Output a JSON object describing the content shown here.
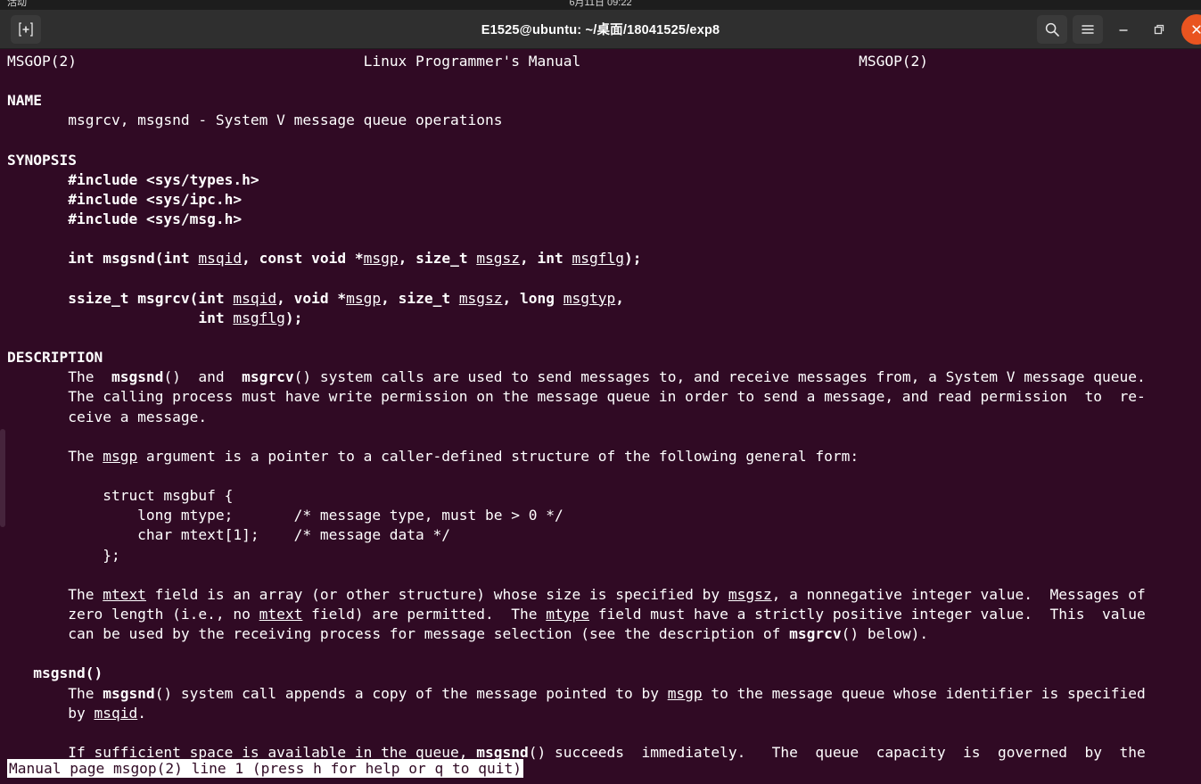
{
  "system_bar": {
    "left_label": "活动",
    "center_label": "6月11日 09:22",
    "right_label": ""
  },
  "titlebar": {
    "new_tab_label": "+",
    "title": "E1525@ubuntu: ~/桌面/18041525/exp8",
    "search_icon": "search-icon",
    "menu_icon": "hamburger-menu-icon",
    "minimize_label": "—",
    "maximize_label": "□",
    "close_label": "×"
  },
  "terminal": {
    "header": {
      "left": "MSGOP(2)",
      "center": "Linux Programmer's Manual",
      "right": "MSGOP(2)"
    },
    "lines": [
      {
        "id": "l1",
        "segments": [
          {
            "t": "MSGOP(2)",
            "s": "n"
          },
          {
            "t": "                                 Linux Programmer's Manual                                MSGOP(2)",
            "s": "n"
          }
        ]
      },
      {
        "id": "l2",
        "segments": [
          {
            "t": "",
            "s": "n"
          }
        ]
      },
      {
        "id": "l3",
        "segments": [
          {
            "t": "NAME",
            "s": "b"
          }
        ]
      },
      {
        "id": "l4",
        "segments": [
          {
            "t": "       msgrcv, msgsnd - System V message queue operations",
            "s": "n"
          }
        ]
      },
      {
        "id": "l5",
        "segments": [
          {
            "t": "",
            "s": "n"
          }
        ]
      },
      {
        "id": "l6",
        "segments": [
          {
            "t": "SYNOPSIS",
            "s": "b"
          }
        ]
      },
      {
        "id": "l7",
        "segments": [
          {
            "t": "       ",
            "s": "n"
          },
          {
            "t": "#include <sys/types.h>",
            "s": "b"
          }
        ]
      },
      {
        "id": "l8",
        "segments": [
          {
            "t": "       ",
            "s": "n"
          },
          {
            "t": "#include <sys/ipc.h>",
            "s": "b"
          }
        ]
      },
      {
        "id": "l9",
        "segments": [
          {
            "t": "       ",
            "s": "n"
          },
          {
            "t": "#include <sys/msg.h>",
            "s": "b"
          }
        ]
      },
      {
        "id": "l10",
        "segments": [
          {
            "t": "",
            "s": "n"
          }
        ]
      },
      {
        "id": "l11",
        "segments": [
          {
            "t": "       ",
            "s": "n"
          },
          {
            "t": "int msgsnd(int ",
            "s": "b"
          },
          {
            "t": "msqid",
            "s": "u"
          },
          {
            "t": ", const void *",
            "s": "b"
          },
          {
            "t": "msgp",
            "s": "u"
          },
          {
            "t": ", size_t ",
            "s": "b"
          },
          {
            "t": "msgsz",
            "s": "u"
          },
          {
            "t": ", int ",
            "s": "b"
          },
          {
            "t": "msgflg",
            "s": "u"
          },
          {
            "t": ");",
            "s": "b"
          }
        ]
      },
      {
        "id": "l12",
        "segments": [
          {
            "t": "",
            "s": "n"
          }
        ]
      },
      {
        "id": "l13",
        "segments": [
          {
            "t": "       ",
            "s": "n"
          },
          {
            "t": "ssize_t msgrcv(int ",
            "s": "b"
          },
          {
            "t": "msqid",
            "s": "u"
          },
          {
            "t": ", void *",
            "s": "b"
          },
          {
            "t": "msgp",
            "s": "u"
          },
          {
            "t": ", size_t ",
            "s": "b"
          },
          {
            "t": "msgsz",
            "s": "u"
          },
          {
            "t": ", long ",
            "s": "b"
          },
          {
            "t": "msgtyp",
            "s": "u"
          },
          {
            "t": ",",
            "s": "b"
          }
        ]
      },
      {
        "id": "l14",
        "segments": [
          {
            "t": "                      ",
            "s": "n"
          },
          {
            "t": "int ",
            "s": "b"
          },
          {
            "t": "msgflg",
            "s": "u"
          },
          {
            "t": ");",
            "s": "b"
          }
        ]
      },
      {
        "id": "l15",
        "segments": [
          {
            "t": "",
            "s": "n"
          }
        ]
      },
      {
        "id": "l16",
        "segments": [
          {
            "t": "DESCRIPTION",
            "s": "b"
          }
        ]
      },
      {
        "id": "l17",
        "segments": [
          {
            "t": "       The  ",
            "s": "n"
          },
          {
            "t": "msgsnd",
            "s": "b"
          },
          {
            "t": "()  and  ",
            "s": "n"
          },
          {
            "t": "msgrcv",
            "s": "b"
          },
          {
            "t": "() system calls are used to send messages to, and receive messages from, a System V message queue.",
            "s": "n"
          }
        ]
      },
      {
        "id": "l18",
        "segments": [
          {
            "t": "       The calling process must have write permission on the message queue in order to send a message, and read permission  to  re-",
            "s": "n"
          }
        ]
      },
      {
        "id": "l19",
        "segments": [
          {
            "t": "       ceive a message.",
            "s": "n"
          }
        ]
      },
      {
        "id": "l20",
        "segments": [
          {
            "t": "",
            "s": "n"
          }
        ]
      },
      {
        "id": "l21",
        "segments": [
          {
            "t": "       The ",
            "s": "n"
          },
          {
            "t": "msgp",
            "s": "u"
          },
          {
            "t": " argument is a pointer to a caller-defined structure of the following general form:",
            "s": "n"
          }
        ]
      },
      {
        "id": "l22",
        "segments": [
          {
            "t": "",
            "s": "n"
          }
        ]
      },
      {
        "id": "l23",
        "segments": [
          {
            "t": "           struct msgbuf {",
            "s": "n"
          }
        ]
      },
      {
        "id": "l24",
        "segments": [
          {
            "t": "               long mtype;       /* message type, must be > 0 */",
            "s": "n"
          }
        ]
      },
      {
        "id": "l25",
        "segments": [
          {
            "t": "               char mtext[1];    /* message data */",
            "s": "n"
          }
        ]
      },
      {
        "id": "l26",
        "segments": [
          {
            "t": "           };",
            "s": "n"
          }
        ]
      },
      {
        "id": "l27",
        "segments": [
          {
            "t": "",
            "s": "n"
          }
        ]
      },
      {
        "id": "l28",
        "segments": [
          {
            "t": "       The ",
            "s": "n"
          },
          {
            "t": "mtext",
            "s": "u"
          },
          {
            "t": " field is an array (or other structure) whose size is specified by ",
            "s": "n"
          },
          {
            "t": "msgsz",
            "s": "u"
          },
          {
            "t": ", a nonnegative integer value.  Messages of",
            "s": "n"
          }
        ]
      },
      {
        "id": "l29",
        "segments": [
          {
            "t": "       zero length (i.e., no ",
            "s": "n"
          },
          {
            "t": "mtext",
            "s": "u"
          },
          {
            "t": " field) are permitted.  The ",
            "s": "n"
          },
          {
            "t": "mtype",
            "s": "u"
          },
          {
            "t": " field must have a strictly positive integer value.  This  value",
            "s": "n"
          }
        ]
      },
      {
        "id": "l30",
        "segments": [
          {
            "t": "       can be used by the receiving process for message selection (see the description of ",
            "s": "n"
          },
          {
            "t": "msgrcv",
            "s": "b"
          },
          {
            "t": "() below).",
            "s": "n"
          }
        ]
      },
      {
        "id": "l31",
        "segments": [
          {
            "t": "",
            "s": "n"
          }
        ]
      },
      {
        "id": "l32",
        "segments": [
          {
            "t": "   ",
            "s": "n"
          },
          {
            "t": "msgsnd()",
            "s": "b"
          }
        ]
      },
      {
        "id": "l33",
        "segments": [
          {
            "t": "       The ",
            "s": "n"
          },
          {
            "t": "msgsnd",
            "s": "b"
          },
          {
            "t": "() system call appends a copy of the message pointed to by ",
            "s": "n"
          },
          {
            "t": "msgp",
            "s": "u"
          },
          {
            "t": " to the message queue whose identifier is specified",
            "s": "n"
          }
        ]
      },
      {
        "id": "l34",
        "segments": [
          {
            "t": "       by ",
            "s": "n"
          },
          {
            "t": "msqid",
            "s": "u"
          },
          {
            "t": ".",
            "s": "n"
          }
        ]
      },
      {
        "id": "l35",
        "segments": [
          {
            "t": "",
            "s": "n"
          }
        ]
      },
      {
        "id": "l36",
        "segments": [
          {
            "t": "       If sufficient space is available in the queue, ",
            "s": "n"
          },
          {
            "t": "msgsnd",
            "s": "b"
          },
          {
            "t": "() succeeds  immediately.   The  queue  capacity  is  governed  by  the",
            "s": "n"
          }
        ]
      }
    ],
    "statusline": "Manual page msgop(2) line 1 (press h for help or q to quit)"
  },
  "colors": {
    "terminal_background": "#300a24",
    "terminal_foreground": "#ffffff",
    "titlebar_background": "#2f2f2f",
    "system_bar_background": "#1d1d1d",
    "close_button": "#e95420",
    "statusline_background": "#ffffff",
    "statusline_foreground": "#300a24"
  }
}
